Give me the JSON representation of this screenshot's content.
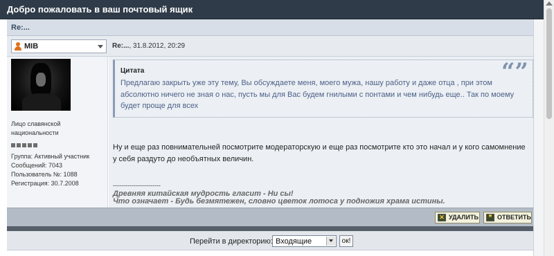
{
  "window": {
    "title": "Добро пожаловать в ваш почтовый ящик"
  },
  "subject": "Re:...",
  "post": {
    "user_select": "MIB",
    "header_subject": "Re:...",
    "header_date": ", 31.8.2012, 20:29",
    "quote": {
      "title": "Цитата",
      "marks": "“”",
      "text": "Предлагаю закрыть уже эту тему, Вы обсуждаете меня, моего мужа, нашу работу и даже отца , при этом абсолютно ничего не зная о нас, пусть мы для Вас будем гнилыми с понтами и чем нибудь еще.. Так по моему будет проще для всех"
    },
    "message": "Ну и еще раз повнимательней посмотрите модераторскую и еще раз посмотрите кто это начал и у кого самомнение у себя раздуто до необъятных величин.",
    "signature_separator": "-----------------------",
    "signature_line1": "Древняя китайская мудрость гласит - Ни сы!",
    "signature_line2": "Что означает - Будь безмятежен, словно цветок лотоса у подножия храма истины."
  },
  "author": {
    "rank_line1": "Лицо славянской",
    "rank_line2": "национальности",
    "rank_level": 5,
    "group": "Группа: Активный участник",
    "posts": "Сообщений: 7043",
    "user_id": "Пользователь №: 1088",
    "registered": "Регистрация: 30.7.2008"
  },
  "actions": {
    "delete_label": "УДАЛИТЬ",
    "delete_icon_char": "✕",
    "reply_label": "ОТВЕТИТЬ",
    "reply_icon_char": "❞"
  },
  "jump": {
    "label": "Перейти в директорию:",
    "selected": "Входящие",
    "ok_label": "ок!"
  }
}
